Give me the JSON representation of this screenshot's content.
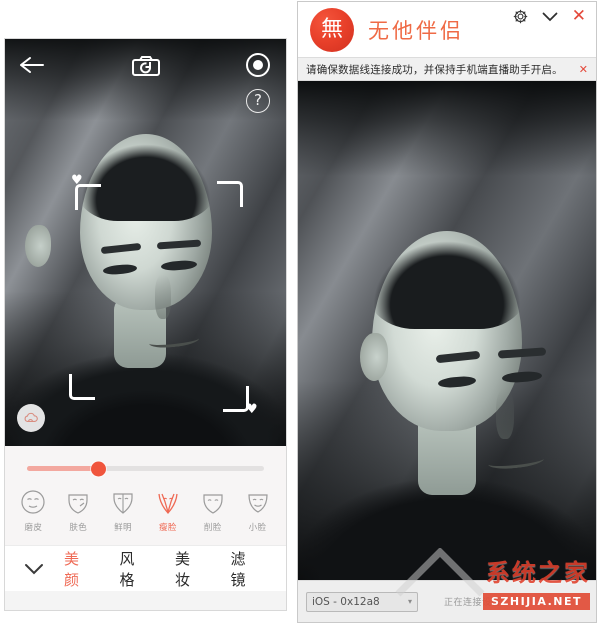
{
  "phone": {
    "camera": {
      "back_icon": "back-arrow-icon",
      "flip_icon": "camera-flip-icon",
      "record_icon": "record-button-icon",
      "help_label": "?",
      "filter_icon": "cloud-filter-icon",
      "face_frame": "face-detect-frame",
      "heart_icon": "♥"
    },
    "slider": {
      "value_percent": 30
    },
    "beauty_items": [
      {
        "label": "磨皮",
        "icon": "smooth-skin-icon",
        "active": false
      },
      {
        "label": "肤色",
        "icon": "skin-tone-icon",
        "active": false
      },
      {
        "label": "鲜明",
        "icon": "vivid-icon",
        "active": false
      },
      {
        "label": "瘦脸",
        "icon": "slim-face-icon",
        "active": true
      },
      {
        "label": "削脸",
        "icon": "contour-face-icon",
        "active": false
      },
      {
        "label": "小脸",
        "icon": "small-face-icon",
        "active": false
      }
    ],
    "tabs": {
      "collapse_icon": "chevron-down-icon",
      "items": [
        {
          "label": "美颜",
          "active": true
        },
        {
          "label": "风格",
          "active": false
        },
        {
          "label": "美妆",
          "active": false
        },
        {
          "label": "滤镜",
          "active": false
        }
      ]
    }
  },
  "window": {
    "logo_glyph": "無",
    "title": "无他伴侣",
    "controls": {
      "settings_icon": "gear-icon",
      "minimize_icon": "chevron-down-icon",
      "close_icon": "✕"
    },
    "notice": {
      "text": "请确保数据线连接成功，并保持手机端直播助手开启。",
      "dismiss_icon": "✕"
    },
    "bottom": {
      "device_value": "iOS - 0x12a8",
      "device_chevron": "▾",
      "status_text": "正在连接设备"
    }
  },
  "watermark": {
    "text": "系统之家",
    "url": "SZHIJIA.NET"
  },
  "colors": {
    "accent": "#ef6a55",
    "brand": "#ef6a45",
    "close_red": "#e4483a",
    "slider_fill": "#f3a89f",
    "slider_thumb": "#f0553d"
  }
}
